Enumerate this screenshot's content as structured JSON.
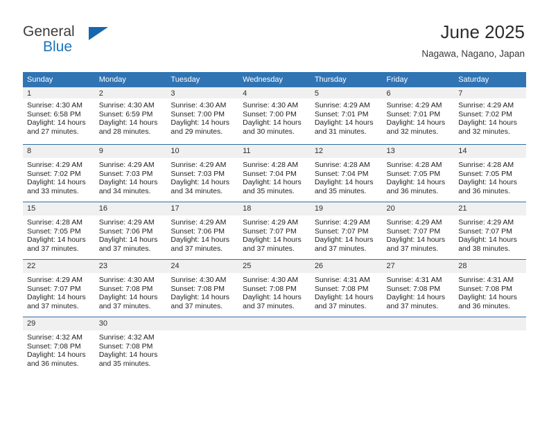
{
  "brand": {
    "name_part1": "General",
    "name_part2": "Blue",
    "flag_icon": "triangle-flag-icon"
  },
  "header": {
    "title": "June 2025",
    "location": "Nagawa, Nagano, Japan"
  },
  "colors": {
    "header_blue": "#3174b4",
    "row_divider_blue": "#2e6da4",
    "daynum_band": "#f0f0f0",
    "brand_blue": "#1a74bb"
  },
  "weekday_headers": [
    "Sunday",
    "Monday",
    "Tuesday",
    "Wednesday",
    "Thursday",
    "Friday",
    "Saturday"
  ],
  "weeks": [
    [
      {
        "day": "1",
        "sunrise": "Sunrise: 4:30 AM",
        "sunset": "Sunset: 6:58 PM",
        "daylight1": "Daylight: 14 hours",
        "daylight2": "and 27 minutes."
      },
      {
        "day": "2",
        "sunrise": "Sunrise: 4:30 AM",
        "sunset": "Sunset: 6:59 PM",
        "daylight1": "Daylight: 14 hours",
        "daylight2": "and 28 minutes."
      },
      {
        "day": "3",
        "sunrise": "Sunrise: 4:30 AM",
        "sunset": "Sunset: 7:00 PM",
        "daylight1": "Daylight: 14 hours",
        "daylight2": "and 29 minutes."
      },
      {
        "day": "4",
        "sunrise": "Sunrise: 4:30 AM",
        "sunset": "Sunset: 7:00 PM",
        "daylight1": "Daylight: 14 hours",
        "daylight2": "and 30 minutes."
      },
      {
        "day": "5",
        "sunrise": "Sunrise: 4:29 AM",
        "sunset": "Sunset: 7:01 PM",
        "daylight1": "Daylight: 14 hours",
        "daylight2": "and 31 minutes."
      },
      {
        "day": "6",
        "sunrise": "Sunrise: 4:29 AM",
        "sunset": "Sunset: 7:01 PM",
        "daylight1": "Daylight: 14 hours",
        "daylight2": "and 32 minutes."
      },
      {
        "day": "7",
        "sunrise": "Sunrise: 4:29 AM",
        "sunset": "Sunset: 7:02 PM",
        "daylight1": "Daylight: 14 hours",
        "daylight2": "and 32 minutes."
      }
    ],
    [
      {
        "day": "8",
        "sunrise": "Sunrise: 4:29 AM",
        "sunset": "Sunset: 7:02 PM",
        "daylight1": "Daylight: 14 hours",
        "daylight2": "and 33 minutes."
      },
      {
        "day": "9",
        "sunrise": "Sunrise: 4:29 AM",
        "sunset": "Sunset: 7:03 PM",
        "daylight1": "Daylight: 14 hours",
        "daylight2": "and 34 minutes."
      },
      {
        "day": "10",
        "sunrise": "Sunrise: 4:29 AM",
        "sunset": "Sunset: 7:03 PM",
        "daylight1": "Daylight: 14 hours",
        "daylight2": "and 34 minutes."
      },
      {
        "day": "11",
        "sunrise": "Sunrise: 4:28 AM",
        "sunset": "Sunset: 7:04 PM",
        "daylight1": "Daylight: 14 hours",
        "daylight2": "and 35 minutes."
      },
      {
        "day": "12",
        "sunrise": "Sunrise: 4:28 AM",
        "sunset": "Sunset: 7:04 PM",
        "daylight1": "Daylight: 14 hours",
        "daylight2": "and 35 minutes."
      },
      {
        "day": "13",
        "sunrise": "Sunrise: 4:28 AM",
        "sunset": "Sunset: 7:05 PM",
        "daylight1": "Daylight: 14 hours",
        "daylight2": "and 36 minutes."
      },
      {
        "day": "14",
        "sunrise": "Sunrise: 4:28 AM",
        "sunset": "Sunset: 7:05 PM",
        "daylight1": "Daylight: 14 hours",
        "daylight2": "and 36 minutes."
      }
    ],
    [
      {
        "day": "15",
        "sunrise": "Sunrise: 4:28 AM",
        "sunset": "Sunset: 7:05 PM",
        "daylight1": "Daylight: 14 hours",
        "daylight2": "and 37 minutes."
      },
      {
        "day": "16",
        "sunrise": "Sunrise: 4:29 AM",
        "sunset": "Sunset: 7:06 PM",
        "daylight1": "Daylight: 14 hours",
        "daylight2": "and 37 minutes."
      },
      {
        "day": "17",
        "sunrise": "Sunrise: 4:29 AM",
        "sunset": "Sunset: 7:06 PM",
        "daylight1": "Daylight: 14 hours",
        "daylight2": "and 37 minutes."
      },
      {
        "day": "18",
        "sunrise": "Sunrise: 4:29 AM",
        "sunset": "Sunset: 7:07 PM",
        "daylight1": "Daylight: 14 hours",
        "daylight2": "and 37 minutes."
      },
      {
        "day": "19",
        "sunrise": "Sunrise: 4:29 AM",
        "sunset": "Sunset: 7:07 PM",
        "daylight1": "Daylight: 14 hours",
        "daylight2": "and 37 minutes."
      },
      {
        "day": "20",
        "sunrise": "Sunrise: 4:29 AM",
        "sunset": "Sunset: 7:07 PM",
        "daylight1": "Daylight: 14 hours",
        "daylight2": "and 37 minutes."
      },
      {
        "day": "21",
        "sunrise": "Sunrise: 4:29 AM",
        "sunset": "Sunset: 7:07 PM",
        "daylight1": "Daylight: 14 hours",
        "daylight2": "and 38 minutes."
      }
    ],
    [
      {
        "day": "22",
        "sunrise": "Sunrise: 4:29 AM",
        "sunset": "Sunset: 7:07 PM",
        "daylight1": "Daylight: 14 hours",
        "daylight2": "and 37 minutes."
      },
      {
        "day": "23",
        "sunrise": "Sunrise: 4:30 AM",
        "sunset": "Sunset: 7:08 PM",
        "daylight1": "Daylight: 14 hours",
        "daylight2": "and 37 minutes."
      },
      {
        "day": "24",
        "sunrise": "Sunrise: 4:30 AM",
        "sunset": "Sunset: 7:08 PM",
        "daylight1": "Daylight: 14 hours",
        "daylight2": "and 37 minutes."
      },
      {
        "day": "25",
        "sunrise": "Sunrise: 4:30 AM",
        "sunset": "Sunset: 7:08 PM",
        "daylight1": "Daylight: 14 hours",
        "daylight2": "and 37 minutes."
      },
      {
        "day": "26",
        "sunrise": "Sunrise: 4:31 AM",
        "sunset": "Sunset: 7:08 PM",
        "daylight1": "Daylight: 14 hours",
        "daylight2": "and 37 minutes."
      },
      {
        "day": "27",
        "sunrise": "Sunrise: 4:31 AM",
        "sunset": "Sunset: 7:08 PM",
        "daylight1": "Daylight: 14 hours",
        "daylight2": "and 37 minutes."
      },
      {
        "day": "28",
        "sunrise": "Sunrise: 4:31 AM",
        "sunset": "Sunset: 7:08 PM",
        "daylight1": "Daylight: 14 hours",
        "daylight2": "and 36 minutes."
      }
    ],
    [
      {
        "day": "29",
        "sunrise": "Sunrise: 4:32 AM",
        "sunset": "Sunset: 7:08 PM",
        "daylight1": "Daylight: 14 hours",
        "daylight2": "and 36 minutes."
      },
      {
        "day": "30",
        "sunrise": "Sunrise: 4:32 AM",
        "sunset": "Sunset: 7:08 PM",
        "daylight1": "Daylight: 14 hours",
        "daylight2": "and 35 minutes."
      },
      {
        "day": "",
        "sunrise": "",
        "sunset": "",
        "daylight1": "",
        "daylight2": ""
      },
      {
        "day": "",
        "sunrise": "",
        "sunset": "",
        "daylight1": "",
        "daylight2": ""
      },
      {
        "day": "",
        "sunrise": "",
        "sunset": "",
        "daylight1": "",
        "daylight2": ""
      },
      {
        "day": "",
        "sunrise": "",
        "sunset": "",
        "daylight1": "",
        "daylight2": ""
      },
      {
        "day": "",
        "sunrise": "",
        "sunset": "",
        "daylight1": "",
        "daylight2": ""
      }
    ]
  ]
}
